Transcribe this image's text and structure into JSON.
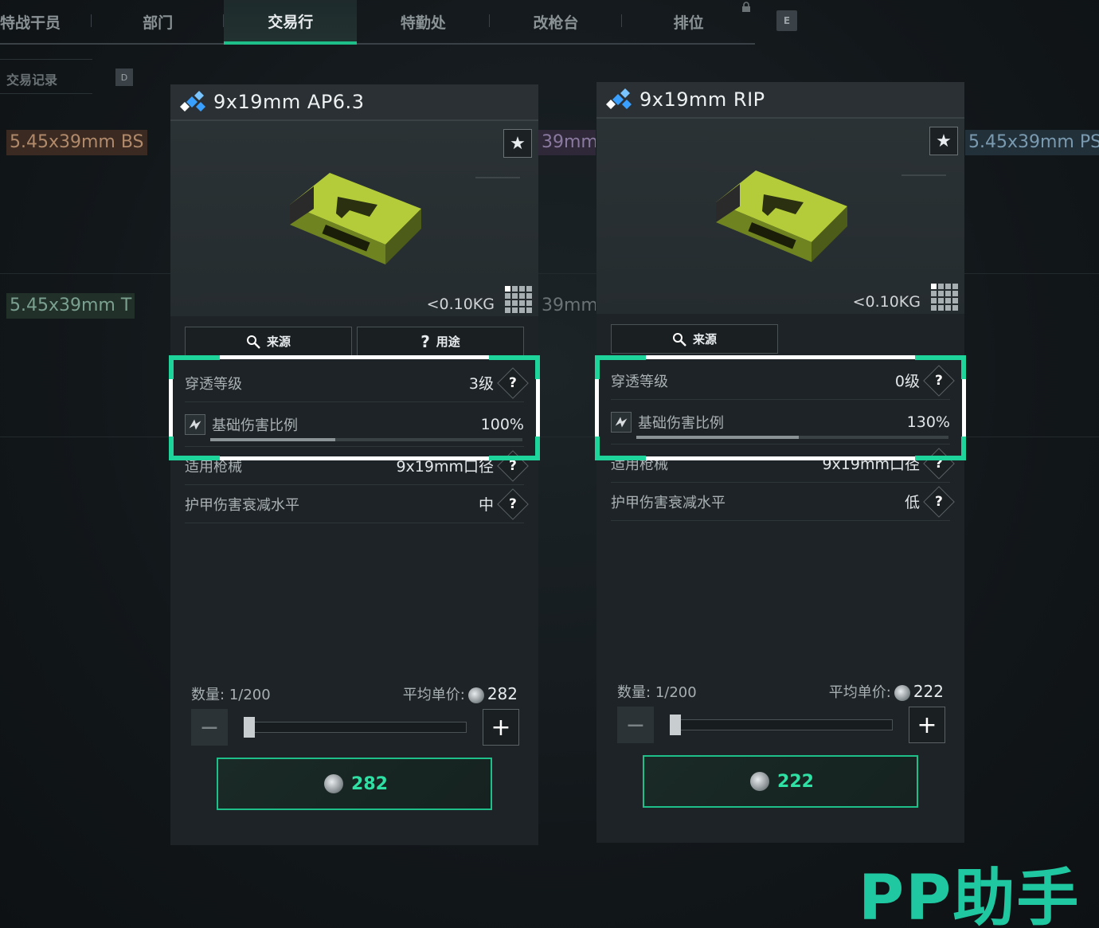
{
  "nav": {
    "tabs": [
      "特战干员",
      "部门",
      "交易行",
      "特勤处",
      "改枪台",
      "排位"
    ],
    "active_tab": "交易行",
    "key_hint": "E"
  },
  "subnav": {
    "label": "交易记录",
    "key_hint": "D"
  },
  "background_tags": [
    {
      "text": "5.45x39mm BS",
      "color": "#3a2a22",
      "fg": "#b08a6a"
    },
    {
      "text": "39mm",
      "color": "#2f2838",
      "fg": "#8a7aa0"
    },
    {
      "text": "5.45x39mm PS",
      "color": "#22303a",
      "fg": "#7a9ab0"
    },
    {
      "text": "5.45x39mm T",
      "color": "#22302a",
      "fg": "#7aa090"
    },
    {
      "text": "39mm",
      "color": "#1d2326",
      "fg": "#6a7276"
    }
  ],
  "cards": [
    {
      "title": "9x19mm AP6.3",
      "weight": "<0.10KG",
      "buttons": {
        "source": "来源",
        "usage": "用途"
      },
      "stats": {
        "penetration": {
          "label": "穿透等级",
          "value": "3级"
        },
        "damage": {
          "label": "基础伤害比例",
          "value": "100%",
          "fill": 0.4
        },
        "weapon": {
          "label": "适用枪械",
          "value": "9x19mm口径"
        },
        "armor": {
          "label": "护甲伤害衰减水平",
          "value": "中"
        }
      },
      "quantity": {
        "label": "数量:",
        "value": "1/200"
      },
      "avg_price": {
        "label": "平均单价:",
        "value": "282"
      },
      "buy_price": "282"
    },
    {
      "title": "9x19mm RIP",
      "weight": "<0.10KG",
      "buttons": {
        "source": "来源"
      },
      "stats": {
        "penetration": {
          "label": "穿透等级",
          "value": "0级"
        },
        "damage": {
          "label": "基础伤害比例",
          "value": "130%",
          "fill": 0.52
        },
        "weapon": {
          "label": "适用枪械",
          "value": "9x19mm口径"
        },
        "armor": {
          "label": "护甲伤害衰减水平",
          "value": "低"
        }
      },
      "quantity": {
        "label": "数量:",
        "value": "1/200"
      },
      "avg_price": {
        "label": "平均单价:",
        "value": "222"
      },
      "buy_price": "222"
    }
  ],
  "watermark": "PP助手",
  "colors": {
    "accent": "#1fd49a",
    "highlight": "#ffffff"
  }
}
